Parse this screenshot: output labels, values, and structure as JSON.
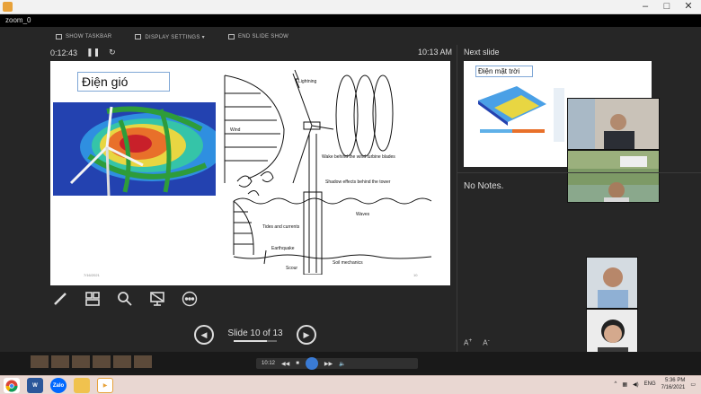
{
  "window": {
    "title": "zoom_0"
  },
  "toolbar": {
    "show_taskbar": "SHOW TASKBAR",
    "display_settings": "DISPLAY SETTINGS ▾",
    "end_slide_show": "END SLIDE SHOW"
  },
  "presenter": {
    "timer": "0:12:43",
    "clock": "10:13 AM",
    "current_slide": {
      "title": "Điện gió",
      "date": "7/16/2021",
      "number": "10",
      "diagram_labels": {
        "lightning": "Lightning",
        "wind": "Wind",
        "wake": "Wake behind the wind turbine blades",
        "shadow": "Shadow effects behind the tower",
        "waves": "Waves",
        "tides": "Tides and currents",
        "earthquake": "Earthquake",
        "scour": "Scour",
        "soil": "Soil mechanics"
      }
    },
    "navigation": {
      "slide_counter": "Slide 10 of 13",
      "progress": 0.77
    },
    "next_slide": {
      "label": "Next slide",
      "title": "Điện mặt trời"
    },
    "notes": "No Notes."
  },
  "player": {
    "time": "10:12"
  },
  "taskbar": {
    "language": "ENG",
    "time": "5:36 PM",
    "date": "7/16/2021",
    "apps": [
      "chrome",
      "word",
      "zalo",
      "file-explorer",
      "media-player"
    ]
  }
}
